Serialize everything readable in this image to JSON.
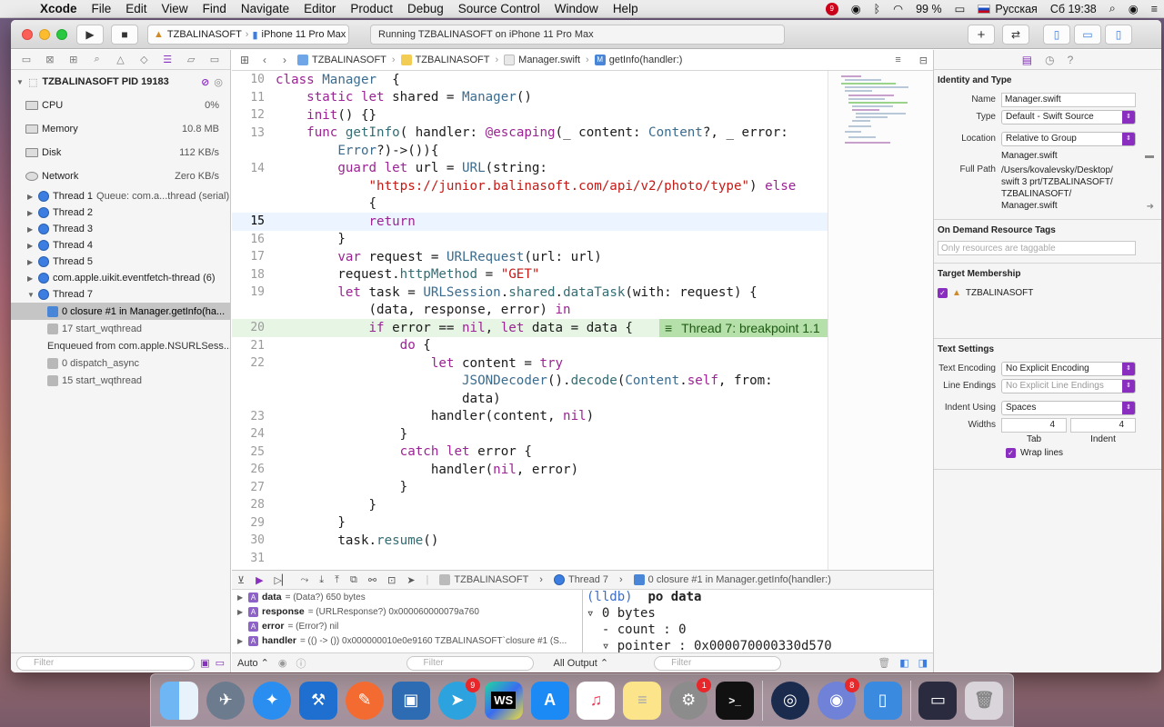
{
  "menubar": {
    "app": "Xcode",
    "items": [
      "File",
      "Edit",
      "View",
      "Find",
      "Navigate",
      "Editor",
      "Product",
      "Debug",
      "Source Control",
      "Window",
      "Help"
    ],
    "badge": "9",
    "battery": "99 %",
    "input_source": "Русская",
    "clock": "Сб 19:38"
  },
  "toolbar": {
    "scheme": "TZBALINASOFT",
    "destination": "iPhone 11 Pro Max",
    "status": "Running TZBALINASOFT on iPhone 11 Pro Max"
  },
  "navigator": {
    "process": "TZBALINASOFT PID 19183",
    "gauges": [
      {
        "label": "CPU",
        "value": "0%"
      },
      {
        "label": "Memory",
        "value": "10.8 MB"
      },
      {
        "label": "Disk",
        "value": "112 KB/s"
      },
      {
        "label": "Network",
        "value": "Zero KB/s"
      }
    ],
    "threads": [
      {
        "label": "Thread 1",
        "detail": "Queue: com.a...thread (serial)"
      },
      {
        "label": "Thread 2",
        "detail": ""
      },
      {
        "label": "Thread 3",
        "detail": ""
      },
      {
        "label": "Thread 4",
        "detail": ""
      },
      {
        "label": "Thread 5",
        "detail": ""
      },
      {
        "label": "com.apple.uikit.eventfetch-thread (6)",
        "detail": ""
      },
      {
        "label": "Thread 7",
        "detail": ""
      }
    ],
    "frames": [
      "0 closure #1 in Manager.getInfo(ha...",
      "17 start_wqthread",
      "Enqueued from com.apple.NSURLSess...",
      "0 dispatch_async",
      "15 start_wqthread"
    ],
    "filter_placeholder": "Filter"
  },
  "jumpbar": {
    "crumbs": [
      "TZBALINASOFT",
      "TZBALINASOFT",
      "Manager.swift",
      "getInfo(handler:)"
    ]
  },
  "code": {
    "lines": [
      {
        "n": "10",
        "t": "class Manager  {"
      },
      {
        "n": "11",
        "t": "    static let shared = Manager()"
      },
      {
        "n": "12",
        "t": "    init() {}"
      },
      {
        "n": "13",
        "t": "    func getInfo( handler: @escaping(_ content: Content?, _ error:"
      },
      {
        "n": "",
        "t": "        Error?)->()){"
      },
      {
        "n": "14",
        "t": "        guard let url = URL(string:"
      },
      {
        "n": "",
        "t": "            \"https://junior.balinasoft.com/api/v2/photo/type\") else"
      },
      {
        "n": "",
        "t": "            {"
      },
      {
        "n": "15",
        "t": "            return"
      },
      {
        "n": "16",
        "t": "        }"
      },
      {
        "n": "17",
        "t": "        var request = URLRequest(url: url)"
      },
      {
        "n": "18",
        "t": "        request.httpMethod = \"GET\""
      },
      {
        "n": "19",
        "t": "        let task = URLSession.shared.dataTask(with: request) {"
      },
      {
        "n": "",
        "t": "            (data, response, error) in"
      },
      {
        "n": "20",
        "t": "            if error == nil, let data = data {"
      },
      {
        "n": "21",
        "t": "                do {"
      },
      {
        "n": "22",
        "t": "                    let content = try"
      },
      {
        "n": "",
        "t": "                        JSONDecoder().decode(Content.self, from:"
      },
      {
        "n": "",
        "t": "                        data)"
      },
      {
        "n": "23",
        "t": "                    handler(content, nil)"
      },
      {
        "n": "24",
        "t": "                }"
      },
      {
        "n": "25",
        "t": "                catch let error {"
      },
      {
        "n": "26",
        "t": "                    handler(nil, error)"
      },
      {
        "n": "27",
        "t": "                }"
      },
      {
        "n": "28",
        "t": "            }"
      },
      {
        "n": "29",
        "t": "        }"
      },
      {
        "n": "30",
        "t": "        task.resume()"
      },
      {
        "n": "31",
        "t": ""
      }
    ],
    "breakpoint_label": "Thread 7: breakpoint 1.1"
  },
  "debugbar": {
    "crumbs": [
      "TZBALINASOFT",
      "Thread 7",
      "0 closure #1 in Manager.getInfo(handler:)"
    ]
  },
  "variables": [
    {
      "name": "data",
      "value": "= (Data?) 650 bytes"
    },
    {
      "name": "response",
      "value": "= (URLResponse?) 0x000060000079a760"
    },
    {
      "name": "error",
      "value": "= (Error?) nil"
    },
    {
      "name": "handler",
      "value": "= (() -> ()) 0x000000010e0e9160 TZBALINASOFT`closure #1 (S..."
    }
  ],
  "console": {
    "prompt": "(lldb)",
    "command": "po data",
    "output": [
      "▿ 0 bytes",
      "  - count : 0",
      "  ▿ pointer : 0x000070000330d570"
    ]
  },
  "debugfoot": {
    "auto": "Auto ⌃",
    "filter": "Filter",
    "all_output": "All Output ⌃",
    "filter2": "Filter"
  },
  "inspector": {
    "identity_title": "Identity and Type",
    "name_label": "Name",
    "name_value": "Manager.swift",
    "type_label": "Type",
    "type_value": "Default - Swift Source",
    "location_label": "Location",
    "location_value": "Relative to Group",
    "location_file": "Manager.swift",
    "fullpath_label": "Full Path",
    "fullpath_value": "/Users/kovalevsky/Desktop/ swift 3 prt/TZBALINASOFT/ TZBALINASOFT/ Manager.swift",
    "odr_title": "On Demand Resource Tags",
    "odr_placeholder": "Only resources are taggable",
    "target_title": "Target Membership",
    "target_name": "TZBALINASOFT",
    "text_title": "Text Settings",
    "enc_label": "Text Encoding",
    "enc_value": "No Explicit Encoding",
    "le_label": "Line Endings",
    "le_value": "No Explicit Line Endings",
    "indent_label": "Indent Using",
    "indent_value": "Spaces",
    "widths_label": "Widths",
    "tab_value": "4",
    "indent_w_value": "4",
    "tab_label": "Tab",
    "indent_sub_label": "Indent",
    "wrap_label": "Wrap lines"
  },
  "dock": {
    "apps": [
      "finder-icon",
      "launchpad-icon",
      "safari-icon",
      "xcode-icon",
      "postman-icon",
      "sim-icon",
      "telegram-icon",
      "webstorm-icon",
      "appstore-icon",
      "music-icon",
      "notes-icon",
      "settings-icon",
      "terminal-icon",
      "steam-icon",
      "discord-icon",
      "simulator-icon",
      "screen-icon",
      "trash-icon"
    ],
    "telegram_badge": "9",
    "settings_badge": "1",
    "discord_badge": "8",
    "webstorm_text": "WS"
  }
}
